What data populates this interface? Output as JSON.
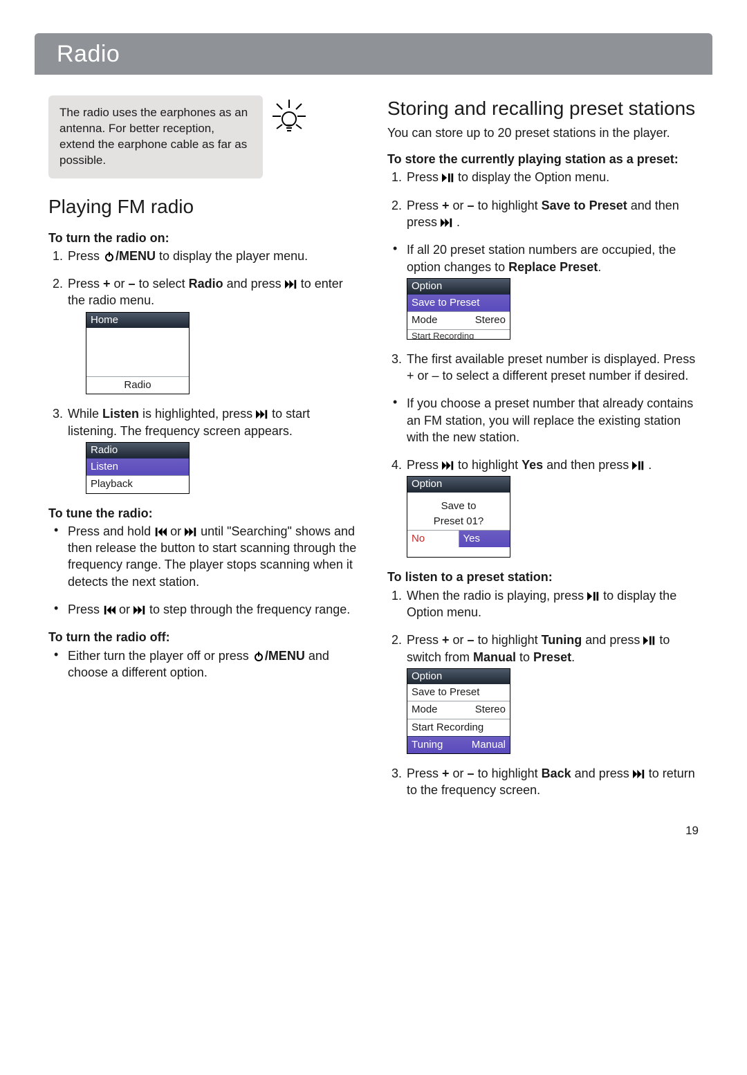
{
  "page_number": "19",
  "header_title": "Radio",
  "left": {
    "tip": "The radio uses the earphones as an antenna. For better reception, extend the earphone cable as far as possible.",
    "section_title": "Playing FM radio",
    "sub1": "To turn the radio on:",
    "step1a": "Press ",
    "step1b": "/MENU",
    "step1c": " to display the player menu.",
    "step2a": "Press ",
    "step2b": "+",
    "step2c": " or ",
    "step2d": "–",
    "step2e": " to select ",
    "step2f": "Radio",
    "step2g": " and press ",
    "step2h": " to enter the radio menu.",
    "dev1_title": "Home",
    "dev1_item": "Radio",
    "step3a": "While ",
    "step3b": "Listen",
    "step3c": " is highlighted, press ",
    "step3d": " to start listening. The frequency screen appears.",
    "dev2_title": "Radio",
    "dev2_item1": "Listen",
    "dev2_item2": "Playback",
    "sub2": "To tune the radio:",
    "tune_b1a": "Press and hold ",
    "tune_b1b": " or ",
    "tune_b1c": " until \"Searching\" shows and then release the button to start scanning through the frequency range. The player stops scanning when it detects the next station.",
    "tune_b2a": "Press ",
    "tune_b2b": " or ",
    "tune_b2c": " to step through the frequency range.",
    "sub3": "To turn the radio off:",
    "off_b1a": "Either turn the player off or press ",
    "off_b1b": "/MENU",
    "off_b1c": " and choose a different option."
  },
  "right": {
    "section_title": "Storing and recalling preset stations",
    "intro": "You can store up to 20 preset stations in the player.",
    "sub1": "To store the currently playing station as a preset:",
    "s1a": "Press ",
    "s1b": " to display the Option menu.",
    "s2a": "Press ",
    "s2b": "+",
    "s2c": " or ",
    "s2d": "–",
    "s2e": " to highlight ",
    "s2f": "Save to Preset",
    "s2g": " and then press ",
    "s2h": " .",
    "s2note_a": "If all 20 preset station numbers are occupied, the option changes to ",
    "s2note_b": "Replace Preset",
    "s2note_c": ".",
    "dev3_title": "Option",
    "dev3_r1": "Save to Preset",
    "dev3_r2a": "Mode",
    "dev3_r2b": "Stereo",
    "dev3_clip": "Start Recording",
    "s3": "The first available preset number is displayed. Press + or – to select a different preset number if desired.",
    "s3b": "If you choose a preset number that already contains an FM station, you will replace the existing station with the new station.",
    "s4a": "Press ",
    "s4b": " to highlight ",
    "s4c": "Yes",
    "s4d": " and then press ",
    "s4e": " .",
    "dev4_title": "Option",
    "dev4_q1": "Save to",
    "dev4_q2": "Preset 01?",
    "dev4_no": "No",
    "dev4_yes": "Yes",
    "sub2": "To listen to a preset station:",
    "l1a": "When the radio is playing, press ",
    "l1b": " to display the Option menu.",
    "l2a": "Press ",
    "l2b": "+",
    "l2c": " or ",
    "l2d": "–",
    "l2e": " to highlight ",
    "l2f": "Tuning",
    "l2g": " and press ",
    "l2h": " to switch from ",
    "l2i": "Manual",
    "l2j": " to ",
    "l2k": "Preset",
    "l2l": ".",
    "dev5_title": "Option",
    "dev5_r1": "Save to Preset",
    "dev5_r2a": "Mode",
    "dev5_r2b": "Stereo",
    "dev5_r3": "Start Recording",
    "dev5_r4a": "Tuning",
    "dev5_r4b": "Manual",
    "l3a": "Press ",
    "l3b": "+",
    "l3c": " or ",
    "l3d": "–",
    "l3e": " to highlight ",
    "l3f": "Back",
    "l3g": " and press ",
    "l3h": " to return to the frequency screen."
  }
}
